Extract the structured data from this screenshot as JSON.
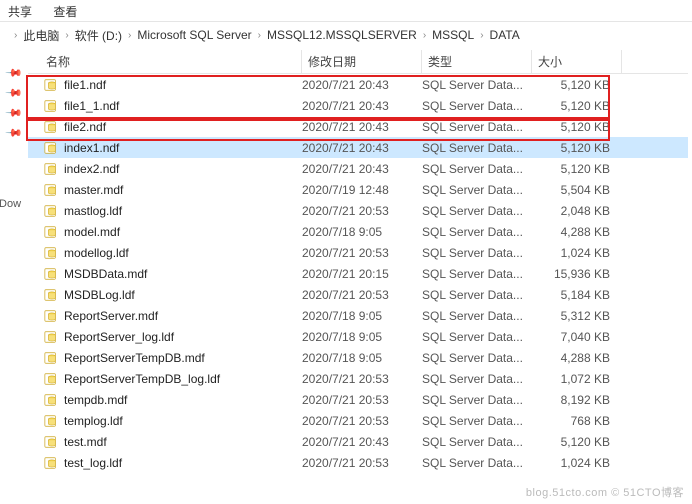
{
  "menu": {
    "share": "共享",
    "view": "查看"
  },
  "breadcrumb": {
    "parts": [
      "此电脑",
      "软件 (D:)",
      "Microsoft SQL Server",
      "MSSQL12.MSSQLSERVER",
      "MSSQL",
      "DATA"
    ]
  },
  "sidebar": {
    "dow": ":Dow"
  },
  "columns": {
    "name": "名称",
    "date": "修改日期",
    "type": "类型",
    "size": "大小"
  },
  "files": [
    {
      "name": "file1.ndf",
      "date": "2020/7/21 20:43",
      "type": "SQL Server Data...",
      "size": "5,120 KB",
      "sel": false,
      "icon": "db"
    },
    {
      "name": "file1_1.ndf",
      "date": "2020/7/21 20:43",
      "type": "SQL Server Data...",
      "size": "5,120 KB",
      "sel": false,
      "icon": "db"
    },
    {
      "name": "file2.ndf",
      "date": "2020/7/21 20:43",
      "type": "SQL Server Data...",
      "size": "5,120 KB",
      "sel": false,
      "icon": "db"
    },
    {
      "name": "index1.ndf",
      "date": "2020/7/21 20:43",
      "type": "SQL Server Data...",
      "size": "5,120 KB",
      "sel": true,
      "icon": "db"
    },
    {
      "name": "index2.ndf",
      "date": "2020/7/21 20:43",
      "type": "SQL Server Data...",
      "size": "5,120 KB",
      "sel": false,
      "icon": "db"
    },
    {
      "name": "master.mdf",
      "date": "2020/7/19 12:48",
      "type": "SQL Server Data...",
      "size": "5,504 KB",
      "sel": false,
      "icon": "db"
    },
    {
      "name": "mastlog.ldf",
      "date": "2020/7/21 20:53",
      "type": "SQL Server Data...",
      "size": "2,048 KB",
      "sel": false,
      "icon": "db"
    },
    {
      "name": "model.mdf",
      "date": "2020/7/18 9:05",
      "type": "SQL Server Data...",
      "size": "4,288 KB",
      "sel": false,
      "icon": "db"
    },
    {
      "name": "modellog.ldf",
      "date": "2020/7/21 20:53",
      "type": "SQL Server Data...",
      "size": "1,024 KB",
      "sel": false,
      "icon": "db"
    },
    {
      "name": "MSDBData.mdf",
      "date": "2020/7/21 20:15",
      "type": "SQL Server Data...",
      "size": "15,936 KB",
      "sel": false,
      "icon": "db"
    },
    {
      "name": "MSDBLog.ldf",
      "date": "2020/7/21 20:53",
      "type": "SQL Server Data...",
      "size": "5,184 KB",
      "sel": false,
      "icon": "db"
    },
    {
      "name": "ReportServer.mdf",
      "date": "2020/7/18 9:05",
      "type": "SQL Server Data...",
      "size": "5,312 KB",
      "sel": false,
      "icon": "db"
    },
    {
      "name": "ReportServer_log.ldf",
      "date": "2020/7/18 9:05",
      "type": "SQL Server Data...",
      "size": "7,040 KB",
      "sel": false,
      "icon": "db"
    },
    {
      "name": "ReportServerTempDB.mdf",
      "date": "2020/7/18 9:05",
      "type": "SQL Server Data...",
      "size": "4,288 KB",
      "sel": false,
      "icon": "db"
    },
    {
      "name": "ReportServerTempDB_log.ldf",
      "date": "2020/7/21 20:53",
      "type": "SQL Server Data...",
      "size": "1,072 KB",
      "sel": false,
      "icon": "db"
    },
    {
      "name": "tempdb.mdf",
      "date": "2020/7/21 20:53",
      "type": "SQL Server Data...",
      "size": "8,192 KB",
      "sel": false,
      "icon": "db"
    },
    {
      "name": "templog.ldf",
      "date": "2020/7/21 20:53",
      "type": "SQL Server Data...",
      "size": "768 KB",
      "sel": false,
      "icon": "db"
    },
    {
      "name": "test.mdf",
      "date": "2020/7/21 20:43",
      "type": "SQL Server Data...",
      "size": "5,120 KB",
      "sel": false,
      "icon": "db"
    },
    {
      "name": "test_log.ldf",
      "date": "2020/7/21 20:53",
      "type": "SQL Server Data...",
      "size": "1,024 KB",
      "sel": false,
      "icon": "db"
    }
  ],
  "watermark": "blog.51cto.com  © 51CTO博客"
}
